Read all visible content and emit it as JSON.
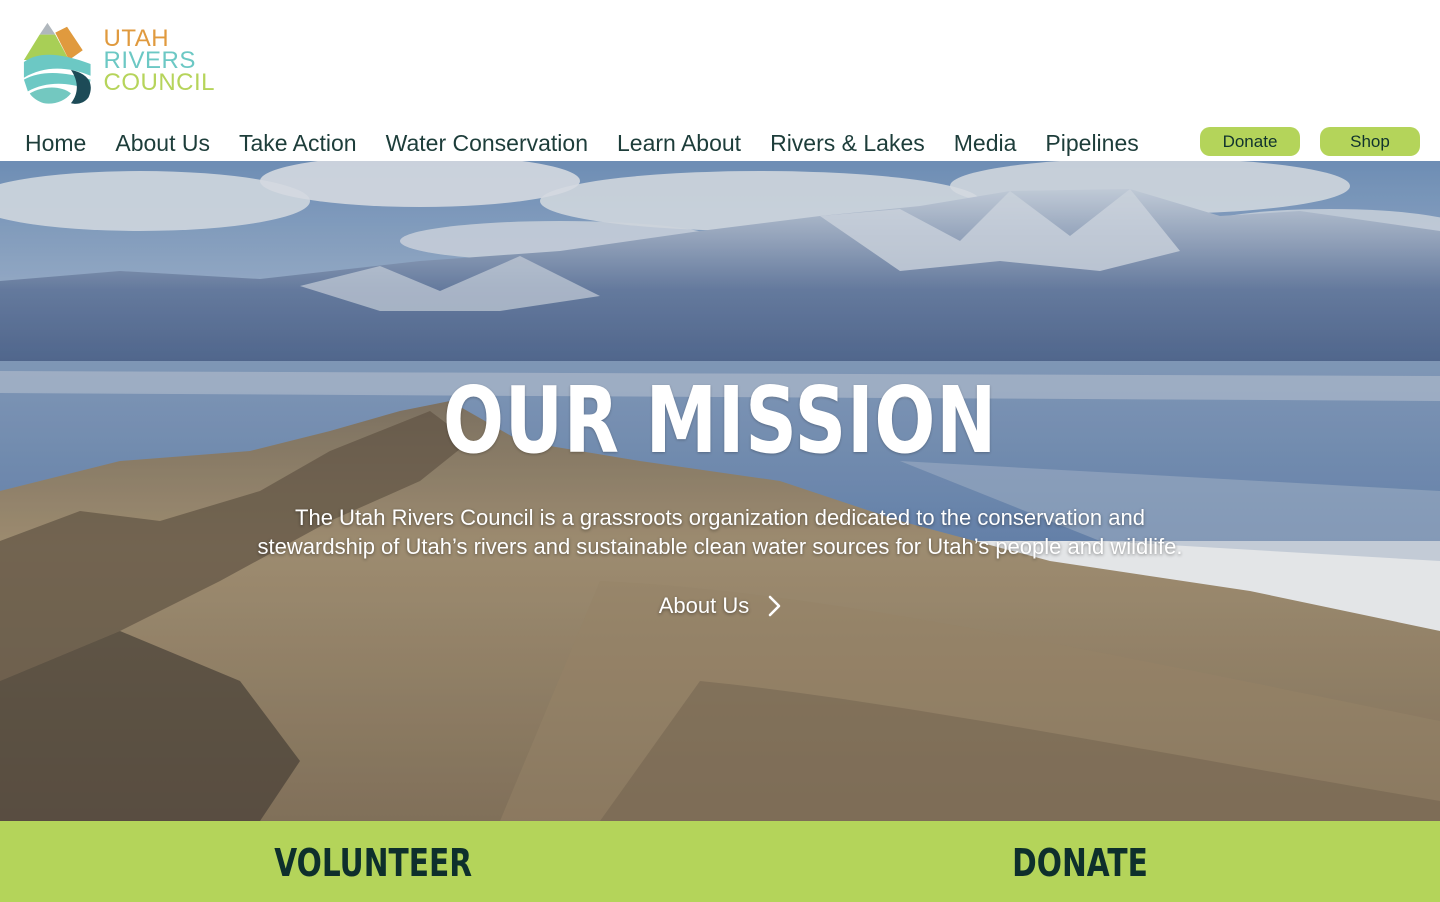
{
  "logo": {
    "line1": "UTAH",
    "line2": "RIVERS",
    "line3": "COUNCIL"
  },
  "nav": {
    "items": [
      "Home",
      "About Us",
      "Take Action",
      "Water Conservation",
      "Learn About",
      "Rivers & Lakes",
      "Media",
      "Pipelines"
    ]
  },
  "header_buttons": {
    "donate": "Donate",
    "shop": "Shop"
  },
  "hero": {
    "title": "OUR MISSION",
    "body_line1": "The Utah Rivers Council is a grassroots organization dedicated to the conservation and",
    "body_line2": "stewardship of Utah’s rivers and sustainable clean water sources for Utah’s people and wildlife.",
    "cta_label": "About Us",
    "cta_icon": "chevron-right-icon"
  },
  "band": {
    "volunteer": "VOLUNTEER",
    "donate": "DONATE"
  },
  "colors": {
    "accent_green": "#b4d45a",
    "dark_teal": "#0e2f2c",
    "logo_orange": "#e09a3e",
    "logo_teal": "#6cc8c4",
    "logo_lime": "#b6d45b"
  }
}
